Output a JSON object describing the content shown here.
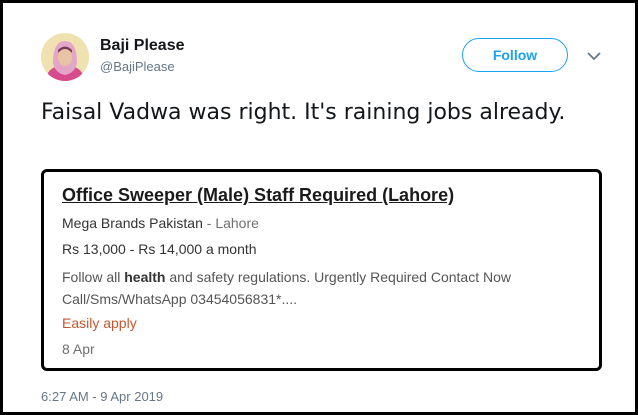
{
  "author": {
    "name": "Baji Please",
    "handle": "@BajiPlease",
    "avatar_icon": "profile-avatar"
  },
  "follow_label": "Follow",
  "caret_icon": "chevron-down-icon",
  "tweet": {
    "text": "Faisal Vadwa was right. It's raining jobs already."
  },
  "job": {
    "title": "Office Sweeper (Male) Staff Required (Lahore)",
    "company": "Mega Brands Pakistan",
    "separator": " - ",
    "location": "Lahore",
    "salary": "Rs 13,000 - Rs 14,000 a month",
    "desc_before": "Follow all ",
    "desc_bold": "health",
    "desc_after": " and safety regulations. Urgently Required Contact Now Call/Sms/WhatsApp 03454056831*....",
    "easy_apply": "Easily apply",
    "date": "8 Apr"
  },
  "timestamp": "6:27 AM - 9 Apr 2019",
  "colors": {
    "twitter_blue": "#1da1f2",
    "easy_apply": "#c5552d",
    "border": "#000000"
  }
}
